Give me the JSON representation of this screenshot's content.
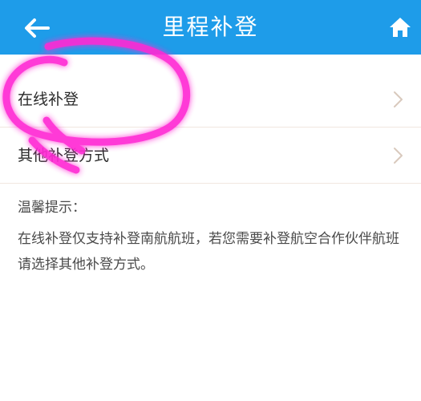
{
  "header": {
    "title": "里程补登",
    "back_icon": "back-arrow-icon",
    "home_icon": "home-icon",
    "background": "#1e9ce9"
  },
  "options": [
    {
      "label": "在线补登"
    },
    {
      "label": "其他补登方式"
    }
  ],
  "hint": {
    "title": "温馨提示：",
    "body": "在线补登仅支持补登南航航班，若您需要补登航空合作伙伴航班请选择其他补登方式。"
  },
  "colors": {
    "accent": "#1e9ce9",
    "chevron": "#d9c9bd",
    "annotation": "#ff2ad4"
  }
}
